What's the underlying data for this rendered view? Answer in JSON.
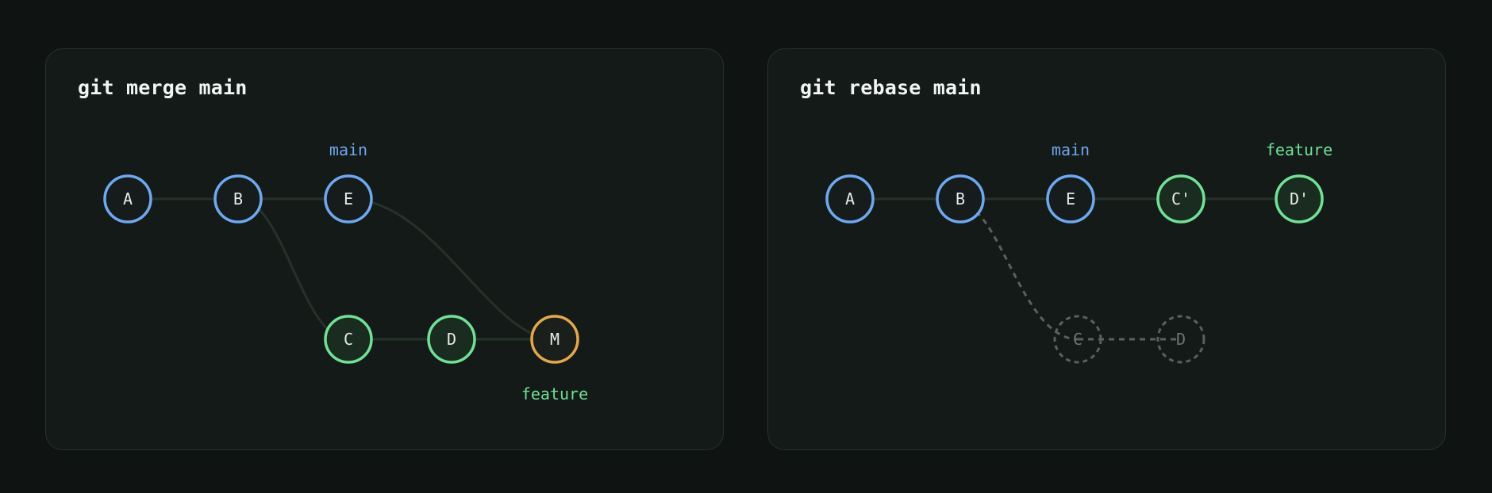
{
  "merge_panel": {
    "title": "git merge main",
    "nodes": {
      "a": "A",
      "b": "B",
      "e": "E",
      "c": "C",
      "d": "D",
      "m": "M"
    },
    "labels": {
      "main": "main",
      "feature": "feature"
    }
  },
  "rebase_panel": {
    "title": "git rebase main",
    "nodes": {
      "a": "A",
      "b": "B",
      "e": "E",
      "c_prime": "C'",
      "d_prime": "D'",
      "c_old": "C",
      "d_old": "D"
    },
    "labels": {
      "main": "main",
      "feature": "feature"
    }
  },
  "colors": {
    "main_branch": "#6fa8f0",
    "feature_branch": "#72e096",
    "merge_commit": "#e3a74d",
    "abandoned_commit": "#5b605d"
  }
}
